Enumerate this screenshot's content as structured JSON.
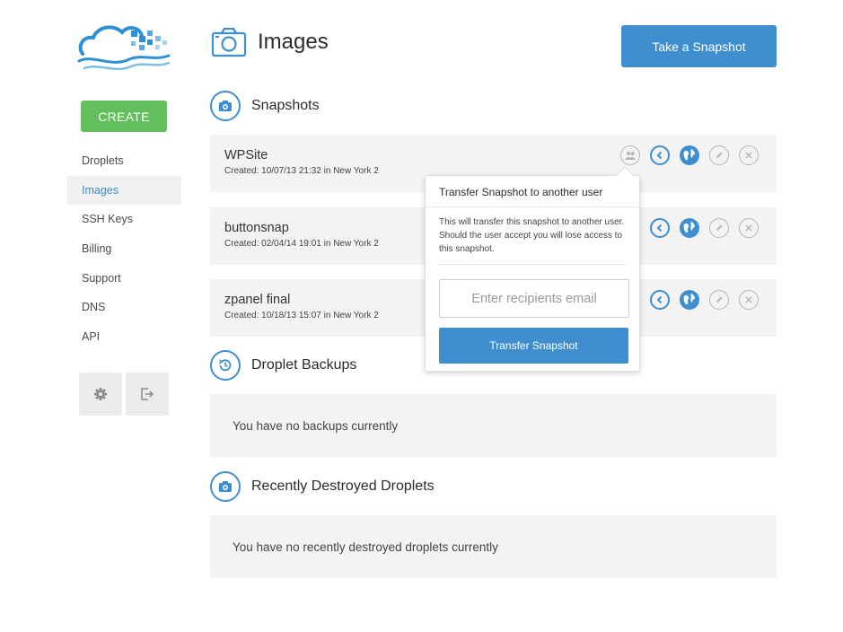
{
  "sidebar": {
    "create_label": "CREATE",
    "items": [
      {
        "label": "Droplets",
        "active": false
      },
      {
        "label": "Images",
        "active": true
      },
      {
        "label": "SSH Keys",
        "active": false
      },
      {
        "label": "Billing",
        "active": false
      },
      {
        "label": "Support",
        "active": false
      },
      {
        "label": "DNS",
        "active": false
      },
      {
        "label": "API",
        "active": false
      }
    ],
    "settings_icon": "gear-icon",
    "logout_icon": "logout-icon"
  },
  "header": {
    "title": "Images",
    "title_icon": "camera-icon",
    "snapshot_button": "Take a Snapshot"
  },
  "snapshots": {
    "title": "Snapshots",
    "items": [
      {
        "name": "WPSite",
        "meta": "Created: 10/07/13 21:32 in New York 2"
      },
      {
        "name": "buttonsnap",
        "meta": "Created: 02/04/14 19:01 in New York 2"
      },
      {
        "name": "zpanel final",
        "meta": "Created: 10/18/13 15:07 in New York 2"
      }
    ]
  },
  "backups": {
    "title": "Droplet Backups",
    "empty": "You have no backups currently"
  },
  "destroyed": {
    "title": "Recently Destroyed Droplets",
    "empty": "You have no recently destroyed droplets currently"
  },
  "popover": {
    "title": "Transfer Snapshot to another user",
    "text": "This will transfer this snapshot to another user. Should the user accept you will lose access to this snapshot.",
    "input_placeholder": "Enter recipients email",
    "button": "Transfer Snapshot"
  },
  "colors": {
    "accent": "#3e8ed0",
    "create": "#62bf5b",
    "row_bg": "#f3f3f3"
  }
}
